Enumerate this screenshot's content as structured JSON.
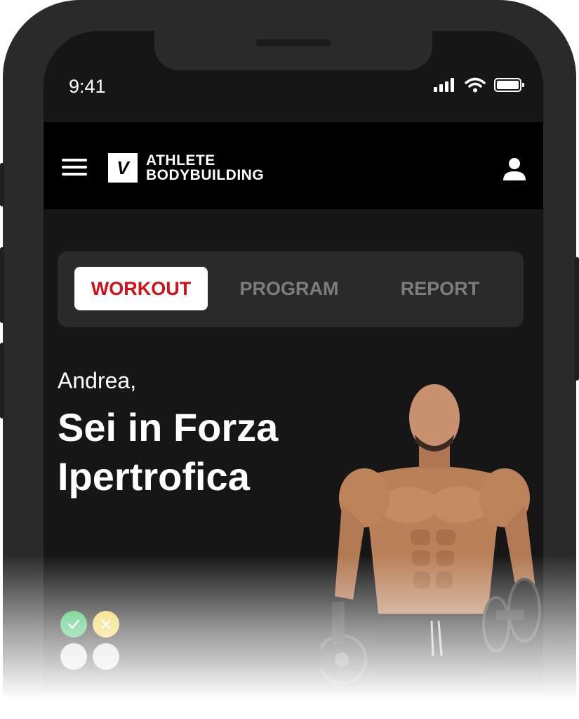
{
  "status_bar": {
    "time": "9:41"
  },
  "header": {
    "logo_mark": "V",
    "brand_line1": "ATHLETE",
    "brand_line2": "BODYBUILDING",
    "icons": [
      "menu-icon",
      "user-icon"
    ]
  },
  "tabs": [
    {
      "label": "WORKOUT",
      "active": true
    },
    {
      "label": "PROGRAM",
      "active": false
    },
    {
      "label": "REPORT",
      "active": false
    }
  ],
  "hero": {
    "greeting": "Andrea,",
    "headline": "Sei in Forza Ipertrofica"
  },
  "status_dots": [
    {
      "state": "done",
      "icon": "check-icon",
      "color": "#2fbf5b"
    },
    {
      "state": "skipped",
      "icon": "x-icon",
      "color": "#f2d24b"
    },
    {
      "state": "pending",
      "icon": "",
      "color": "#d6d6d6"
    },
    {
      "state": "pending",
      "icon": "",
      "color": "#d6d6d6"
    }
  ],
  "colors": {
    "accent": "#d0111a",
    "background": "#161616",
    "header": "#000000",
    "tab_bar": "#2a2a2a"
  }
}
